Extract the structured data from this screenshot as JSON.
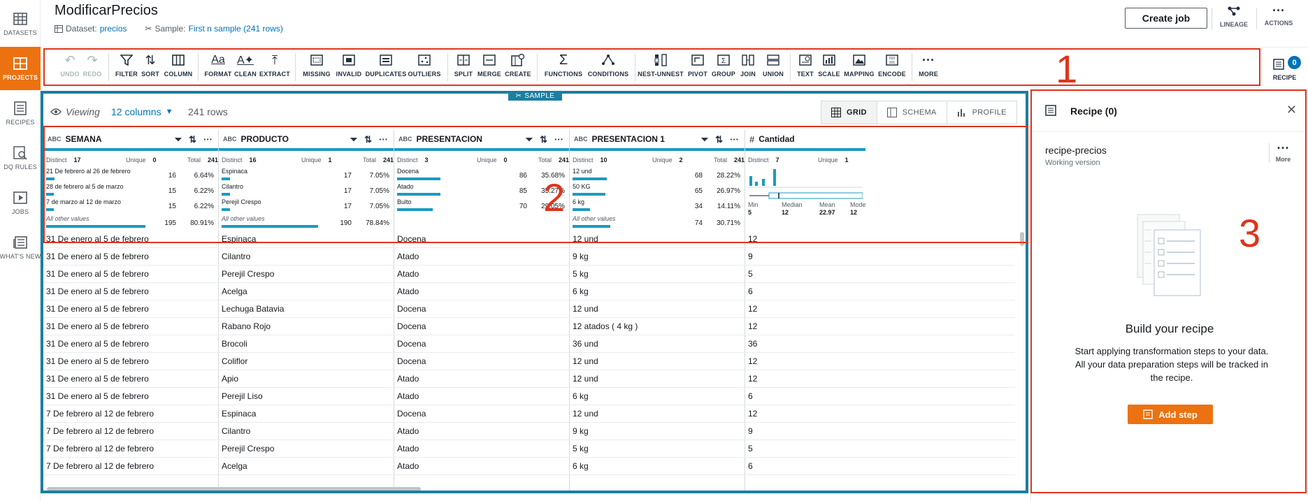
{
  "leftnav": {
    "items": [
      {
        "label": "DATASETS",
        "icon": "table-icon"
      },
      {
        "label": "PROJECTS",
        "icon": "grid-icon"
      },
      {
        "label": "RECIPES",
        "icon": "list-icon"
      },
      {
        "label": "DQ RULES",
        "icon": "rules-icon"
      },
      {
        "label": "JOBS",
        "icon": "play-icon"
      },
      {
        "label": "WHAT'S NEW",
        "icon": "news-icon"
      }
    ]
  },
  "header": {
    "title": "ModificarPrecios",
    "dataset_label": "Dataset:",
    "dataset_value": "precios",
    "sample_label": "Sample:",
    "sample_value": "First n sample (241 rows)",
    "create_job": "Create job",
    "lineage": "LINEAGE",
    "actions": "ACTIONS"
  },
  "toolbar": {
    "undo": "UNDO",
    "redo": "REDO",
    "filter": "FILTER",
    "sort": "SORT",
    "column": "COLUMN",
    "format": "FORMAT",
    "clean": "CLEAN",
    "extract": "EXTRACT",
    "missing": "MISSING",
    "invalid": "INVALID",
    "duplicates": "DUPLICATES",
    "outliers": "OUTLIERS",
    "split": "SPLIT",
    "merge": "MERGE",
    "create": "CREATE",
    "functions": "FUNCTIONS",
    "conditions": "CONDITIONS",
    "nest": "NEST-UNNEST",
    "pivot": "PIVOT",
    "group": "GROUP",
    "join": "JOIN",
    "union": "UNION",
    "text": "TEXT",
    "scale": "SCALE",
    "mapping": "MAPPING",
    "encode": "ENCODE",
    "more": "MORE",
    "recipe": "RECIPE",
    "recipe_count": "0"
  },
  "annotations": {
    "a1": "1",
    "a2": "2",
    "a3": "3"
  },
  "grid": {
    "sample_tag": "SAMPLE",
    "viewing": "Viewing",
    "columns": "12 columns",
    "rows": "241 rows",
    "views": {
      "grid": "GRID",
      "schema": "SCHEMA",
      "profile": "PROFILE"
    },
    "columns_list": [
      {
        "type": "ABC",
        "name": "SEMANA"
      },
      {
        "type": "ABC",
        "name": "PRODUCTO"
      },
      {
        "type": "ABC",
        "name": "PRESENTACION"
      },
      {
        "type": "ABC",
        "name": "PRESENTACION 1"
      },
      {
        "type": "#",
        "name": "Cantidad"
      }
    ],
    "stat_labels": {
      "distinct": "Distinct",
      "unique": "Unique",
      "total": "Total"
    },
    "stats": [
      {
        "distinct": "17",
        "unique": "0",
        "total": "241",
        "values": [
          {
            "label": "21 De febrero al 26 de febrero",
            "count": "16",
            "pct": "6.64%",
            "share": 0.0664
          },
          {
            "label": "28 de febrero al 5 de marzo",
            "count": "15",
            "pct": "6.22%",
            "share": 0.0622
          },
          {
            "label": "7 de marzo al 12 de marzo",
            "count": "15",
            "pct": "6.22%",
            "share": 0.0622
          },
          {
            "label": "All other values",
            "count": "195",
            "pct": "80.91%",
            "share": 0.8091
          }
        ]
      },
      {
        "distinct": "16",
        "unique": "1",
        "total": "241",
        "values": [
          {
            "label": "Espinaca",
            "count": "17",
            "pct": "7.05%",
            "share": 0.0705
          },
          {
            "label": "Cilantro",
            "count": "17",
            "pct": "7.05%",
            "share": 0.0705
          },
          {
            "label": "Perejil Crespo",
            "count": "17",
            "pct": "7.05%",
            "share": 0.0705
          },
          {
            "label": "All other values",
            "count": "190",
            "pct": "78.84%",
            "share": 0.7884
          }
        ]
      },
      {
        "distinct": "3",
        "unique": "0",
        "total": "241",
        "values": [
          {
            "label": "Docena",
            "count": "86",
            "pct": "35.68%",
            "share": 0.3568
          },
          {
            "label": "Atado",
            "count": "85",
            "pct": "35.27%",
            "share": 0.3527
          },
          {
            "label": "Bulto",
            "count": "70",
            "pct": "29.05%",
            "share": 0.2905
          }
        ]
      },
      {
        "distinct": "10",
        "unique": "2",
        "total": "241",
        "values": [
          {
            "label": "12 und",
            "count": "68",
            "pct": "28.22%",
            "share": 0.2822
          },
          {
            "label": "50 KG",
            "count": "65",
            "pct": "26.97%",
            "share": 0.2697
          },
          {
            "label": "6 kg",
            "count": "34",
            "pct": "14.11%",
            "share": 0.1411
          },
          {
            "label": "All other values",
            "count": "74",
            "pct": "30.71%",
            "share": 0.3071
          }
        ]
      },
      {
        "distinct": "7",
        "unique": "1",
        "total": "241",
        "numeric": {
          "min_label": "Min",
          "min": "5",
          "median_label": "Median",
          "median": "12",
          "mean_label": "Mean",
          "mean": "22.97",
          "mode_label": "Mode",
          "mode": "12"
        }
      }
    ],
    "rows_data": [
      [
        "31 De enero al 5 de febrero",
        "Espinaca",
        "Docena",
        "12 und",
        "12"
      ],
      [
        "31 De enero al 5 de febrero",
        "Cilantro",
        "Atado",
        "9 kg",
        "9"
      ],
      [
        "31 De enero al 5 de febrero",
        "Perejil Crespo",
        "Atado",
        "5 kg",
        "5"
      ],
      [
        "31 De enero al 5 de febrero",
        "Acelga",
        "Atado",
        "6 kg",
        "6"
      ],
      [
        "31 De enero al 5 de febrero",
        "Lechuga Batavia",
        "Docena",
        "12 und",
        "12"
      ],
      [
        "31 De enero al 5 de febrero",
        "Rabano Rojo",
        "Docena",
        "12 atados ( 4 kg )",
        "12"
      ],
      [
        "31 De enero al 5 de febrero",
        "Brocoli",
        "Docena",
        "36 und",
        "36"
      ],
      [
        "31 De enero al 5 de febrero",
        "Coliflor",
        "Docena",
        "12 und",
        "12"
      ],
      [
        "31 De enero al 5 de febrero",
        "Apio",
        "Atado",
        "12 und",
        "12"
      ],
      [
        "31 De enero al 5 de febrero",
        "Perejil Liso",
        "Atado",
        "6 kg",
        "6"
      ],
      [
        "7 De febrero al 12 de febrero",
        "Espinaca",
        "Docena",
        "12 und",
        "12"
      ],
      [
        "7 De febrero al 12 de febrero",
        "Cilantro",
        "Atado",
        "9 kg",
        "9"
      ],
      [
        "7 De febrero al 12 de febrero",
        "Perejil Crespo",
        "Atado",
        "5 kg",
        "5"
      ],
      [
        "7 De febrero al 12 de febrero",
        "Acelga",
        "Atado",
        "6 kg",
        "6"
      ]
    ]
  },
  "recipe": {
    "title": "Recipe (0)",
    "name": "recipe-precios",
    "version": "Working version",
    "more": "More",
    "build": "Build your recipe",
    "desc": "Start applying transformation steps to your data. All your data preparation steps will be tracked in the recipe.",
    "add_step": "Add step"
  },
  "colors": {
    "accent": "#ec7211",
    "link": "#0073bb",
    "teal": "#1b7fa1",
    "annotation": "#e0331c"
  }
}
